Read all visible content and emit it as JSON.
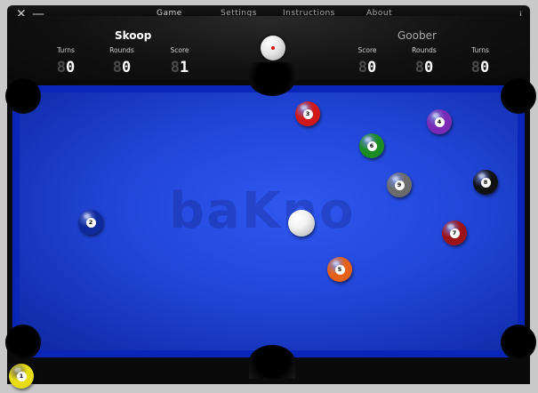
{
  "menu": {
    "items": [
      "Game",
      "Settings",
      "Instructions",
      "About"
    ],
    "close_glyph": "✕",
    "minimize_glyph": "—",
    "info_glyph": "i"
  },
  "players": {
    "p1": {
      "name": "Skoop",
      "turns": "0",
      "rounds": "0",
      "score": "1"
    },
    "p2": {
      "name": "Goober",
      "score": "0",
      "rounds": "0",
      "turns": "0"
    }
  },
  "labels": {
    "turns": "Turns",
    "rounds": "Rounds",
    "score": "Score"
  },
  "digit_ghost": "8",
  "watermark": "baKno",
  "balls": [
    {
      "id": "2",
      "color": "#0e2a9a"
    },
    {
      "id": "3",
      "color": "#d01818"
    },
    {
      "id": "4",
      "color": "#7a2bb6"
    },
    {
      "id": "5",
      "color": "#e5611a"
    },
    {
      "id": "6",
      "color": "#1b8c24"
    },
    {
      "id": "7",
      "color": "#9c1418"
    },
    {
      "id": "8",
      "color": "#111111"
    },
    {
      "id": "9",
      "color": "#6b6b6b"
    },
    {
      "id": "1",
      "color": "#e8dc12"
    }
  ],
  "colors": {
    "cloth": "#2146d8",
    "rail": "#0a0a0a",
    "cue_ball": "#f2f2f2"
  }
}
